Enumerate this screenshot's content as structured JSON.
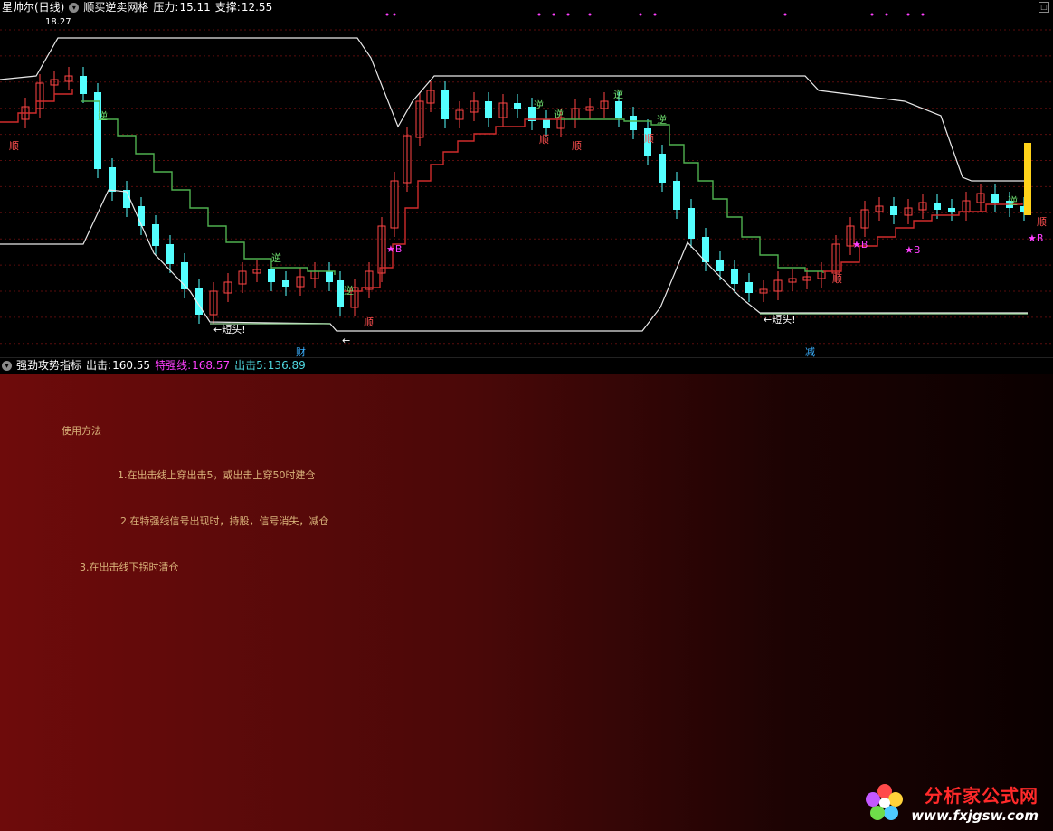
{
  "top_header": {
    "stock": "星帅尔(日线)",
    "indicator": "顺买逆卖网格",
    "resistance_label": "压力:",
    "resistance_value": "15.11",
    "support_label": "支撑:",
    "support_value": "12.55"
  },
  "bottom_header": {
    "indicator": "强劲攻势指标",
    "attack_label": "出击:",
    "attack_value": "160.55",
    "strong_label": "特强线:",
    "strong_value": "168.57",
    "attack5_label": "出击5:",
    "attack5_value": "136.89"
  },
  "markers": {
    "cai": "财",
    "jian": "减",
    "price_high": "18.27",
    "shun": "顺",
    "ni": "逆",
    "star_b": "★B",
    "short_top": "←短头!",
    "short_top2": "←短头!",
    "left_arrow": "←"
  },
  "usage": {
    "title": "使用方法",
    "line1": "1.在出击线上穿出击5，或出击上穿50时建仓",
    "line2": "2.在特强线信号出现时，持股，信号消失，减仓",
    "line3": "3.在出击线下拐时清仓"
  },
  "watermark": {
    "cn": "分析家公式网",
    "url": "www.fxjgsw.com"
  },
  "colors": {
    "up": "#ff4545",
    "down": "#54ffff",
    "ladder_red": "#d02c2c",
    "ladder_green": "#4fb04f",
    "channel": "#e8e8e8",
    "support_line": "#9ad79a",
    "attack_line": "#ffee70",
    "attack5_line": "#4fd8e0",
    "strong_line": "#ff40ff",
    "hint": "#d9b37a"
  },
  "chart_data": [
    {
      "type": "candlestick",
      "title": "顺买逆卖网格",
      "series": [
        {
          "name": "压力",
          "last": 15.11
        },
        {
          "name": "支撑",
          "last": 12.55
        }
      ],
      "annotations": [
        "18.27",
        "顺",
        "逆",
        "★B",
        "←短头!",
        "财",
        "减"
      ]
    },
    {
      "type": "line",
      "title": "强劲攻势指标",
      "series": [
        {
          "name": "出击",
          "last": 160.55
        },
        {
          "name": "特强线",
          "last": 168.57
        },
        {
          "name": "出击5",
          "last": 136.89
        }
      ]
    }
  ]
}
